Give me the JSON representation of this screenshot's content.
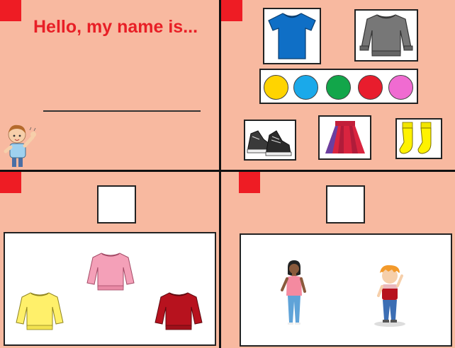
{
  "worksheet": {
    "greeting": "Hello, my name is...",
    "name_line_value": ""
  },
  "colors": {
    "background": "#f8b9a0",
    "accent_red": "#ee1c24",
    "title_red": "#e81f26",
    "palette": [
      "#ffd400",
      "#1aa9ea",
      "#12a64a",
      "#e81d2d",
      "#f06bd1"
    ]
  },
  "clothing_icons": [
    "tshirt-icon",
    "sweater-icon",
    "sneakers-icon",
    "skirt-icon",
    "socks-icon"
  ],
  "sweaters": [
    "pink-sweater-icon",
    "yellow-sweater-icon",
    "red-sweater-icon"
  ],
  "people": [
    "girl-icon",
    "boy-icon"
  ],
  "decor": [
    "waving-boy-icon"
  ]
}
